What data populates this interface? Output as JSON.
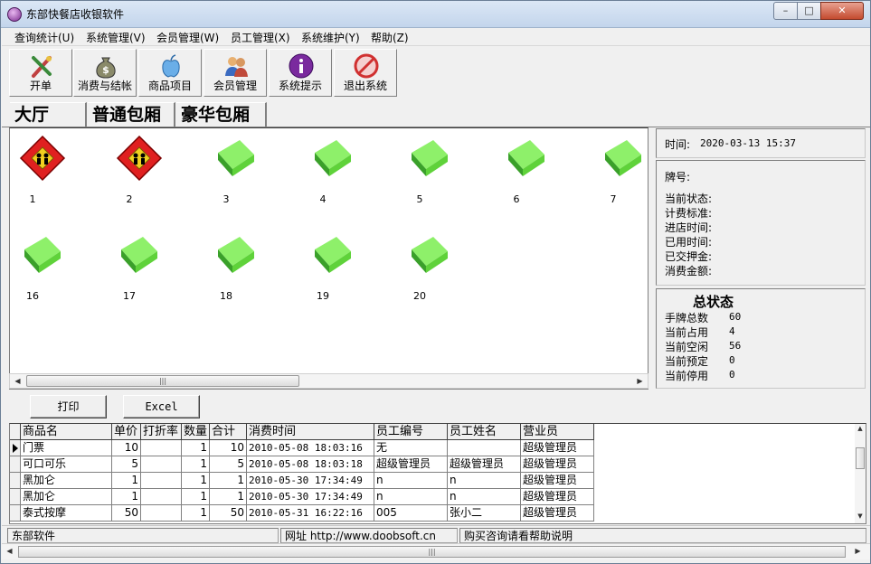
{
  "window": {
    "title": "东部快餐店收银软件"
  },
  "menu": [
    "查询统计(U)",
    "系统管理(V)",
    "会员管理(W)",
    "员工管理(X)",
    "系统维护(Y)",
    "帮助(Z)"
  ],
  "toolbar": [
    {
      "label": "开单",
      "icon": "brush-icon"
    },
    {
      "label": "消费与结帐",
      "icon": "money-bag-icon"
    },
    {
      "label": "商品项目",
      "icon": "apple-icon"
    },
    {
      "label": "会员管理",
      "icon": "members-icon"
    },
    {
      "label": "系统提示",
      "icon": "info-icon"
    },
    {
      "label": "退出系统",
      "icon": "exit-icon"
    }
  ],
  "room_tabs": [
    "大厅",
    "普通包厢",
    "豪华包厢"
  ],
  "rooms_row1": [
    {
      "num": "1",
      "status": "occupied"
    },
    {
      "num": "2",
      "status": "occupied"
    },
    {
      "num": "3",
      "status": "free"
    },
    {
      "num": "4",
      "status": "free"
    },
    {
      "num": "5",
      "status": "free"
    },
    {
      "num": "6",
      "status": "free"
    },
    {
      "num": "7",
      "status": "free"
    }
  ],
  "rooms_row2": [
    {
      "num": "16",
      "status": "free"
    },
    {
      "num": "17",
      "status": "free"
    },
    {
      "num": "18",
      "status": "free"
    },
    {
      "num": "19",
      "status": "free"
    },
    {
      "num": "20",
      "status": "free"
    }
  ],
  "info": {
    "time_label": "时间:",
    "time_value": "2020-03-13 15:37",
    "plate_label": "牌号:",
    "fields": [
      "当前状态:",
      "计费标准:",
      "进店时间:",
      "已用时间:",
      "已交押金:",
      "消费金额:"
    ]
  },
  "status": {
    "title": "总状态",
    "items": [
      {
        "label": "手牌总数",
        "value": "60"
      },
      {
        "label": "当前占用",
        "value": "4"
      },
      {
        "label": "当前空闲",
        "value": "56"
      },
      {
        "label": "当前预定",
        "value": "0"
      },
      {
        "label": "当前停用",
        "value": "0"
      }
    ]
  },
  "buttons": {
    "print": "打印",
    "excel": "Excel"
  },
  "table": {
    "headers": [
      "商品名",
      "单价",
      "打折率",
      "数量",
      "合计",
      "消费时间",
      "员工编号",
      "员工姓名",
      "营业员"
    ],
    "rows": [
      [
        "门票",
        "10",
        "",
        "1",
        "10",
        "2010-05-08 18:03:16",
        "无",
        "",
        "超级管理员"
      ],
      [
        "可口可乐",
        "5",
        "",
        "1",
        "5",
        "2010-05-08 18:03:18",
        "超级管理员",
        "超级管理员",
        "超级管理员"
      ],
      [
        "黑加仑",
        "1",
        "",
        "1",
        "1",
        "2010-05-30 17:34:49",
        "n",
        "n",
        "超级管理员"
      ],
      [
        "黑加仑",
        "1",
        "",
        "1",
        "1",
        "2010-05-30 17:34:49",
        "n",
        "n",
        "超级管理员"
      ],
      [
        "泰式按摩",
        "50",
        "",
        "1",
        "50",
        "2010-05-31 16:22:16",
        "005",
        "张小二",
        "超级管理员"
      ]
    ]
  },
  "statusbar": [
    "东部软件",
    "网址 http://www.doobsoft.cn",
    "购买咨询请看帮助说明"
  ],
  "colors": {
    "occupied": "#e02020",
    "free": "#5fd23a",
    "title_bg": "#c9daee"
  }
}
